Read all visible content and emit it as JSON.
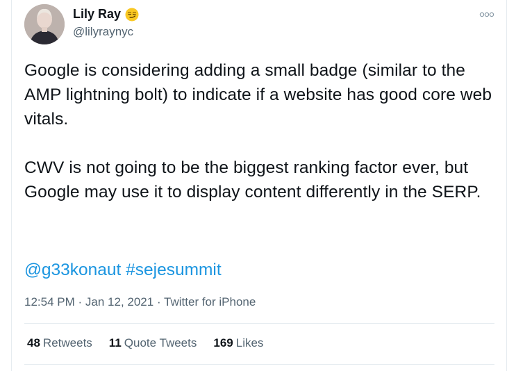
{
  "author": {
    "display_name": "Lily Ray",
    "handle": "@lilyraynyc",
    "emoji": "smirking-face"
  },
  "tweet": {
    "paragraph1": "Google is considering adding a small badge (similar to the AMP lightning bolt) to indicate if a website has good core web vitals.",
    "paragraph2": "CWV is not going to be the biggest ranking factor ever, but Google may use it to display content differently in the SERP.",
    "mention": "@g33konaut",
    "hashtag": "#sejesummit"
  },
  "meta": {
    "time": "12:54 PM",
    "separator": "·",
    "date": "Jan 12, 2021",
    "source": "Twitter for iPhone"
  },
  "stats": {
    "retweets_count": "48",
    "retweets_label": "Retweets",
    "quotes_count": "11",
    "quotes_label": "Quote Tweets",
    "likes_count": "169",
    "likes_label": "Likes"
  },
  "colors": {
    "link": "#1b95e0",
    "secondary_text": "#536471",
    "divider": "#e6ecf0"
  }
}
